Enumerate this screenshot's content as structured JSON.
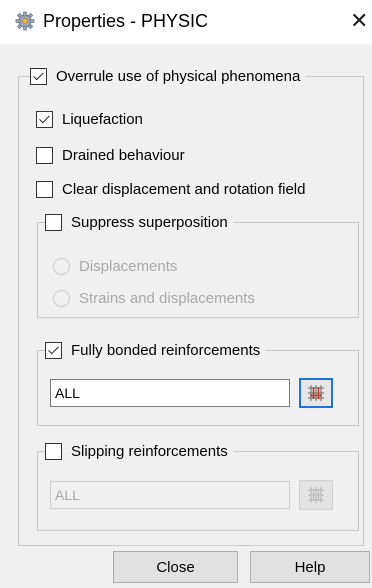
{
  "window": {
    "title": "Properties - PHYSIC",
    "icon": "gear-icon",
    "close_glyph": "✕"
  },
  "overrule": {
    "label": "Overrule use of physical phenomena",
    "checked": true
  },
  "liquefaction": {
    "label": "Liquefaction",
    "checked": true
  },
  "drained": {
    "label": "Drained behaviour",
    "checked": false
  },
  "clear_displacement": {
    "label": "Clear displacement and rotation field",
    "checked": false
  },
  "suppress": {
    "label": "Suppress superposition",
    "checked": false,
    "options": [
      "Displacements",
      "Strains and displacements"
    ]
  },
  "fully_bonded": {
    "label": "Fully bonded reinforcements",
    "checked": true,
    "value": "ALL",
    "picker_icon": "grid-pick-icon"
  },
  "slipping": {
    "label": "Slipping reinforcements",
    "checked": false,
    "value": "ALL",
    "picker_icon": "grid-pick-icon"
  },
  "buttons": {
    "close": "Close",
    "help": "Help"
  },
  "colors": {
    "accent": "#1e73d8",
    "grid_red": "#c0392b"
  }
}
